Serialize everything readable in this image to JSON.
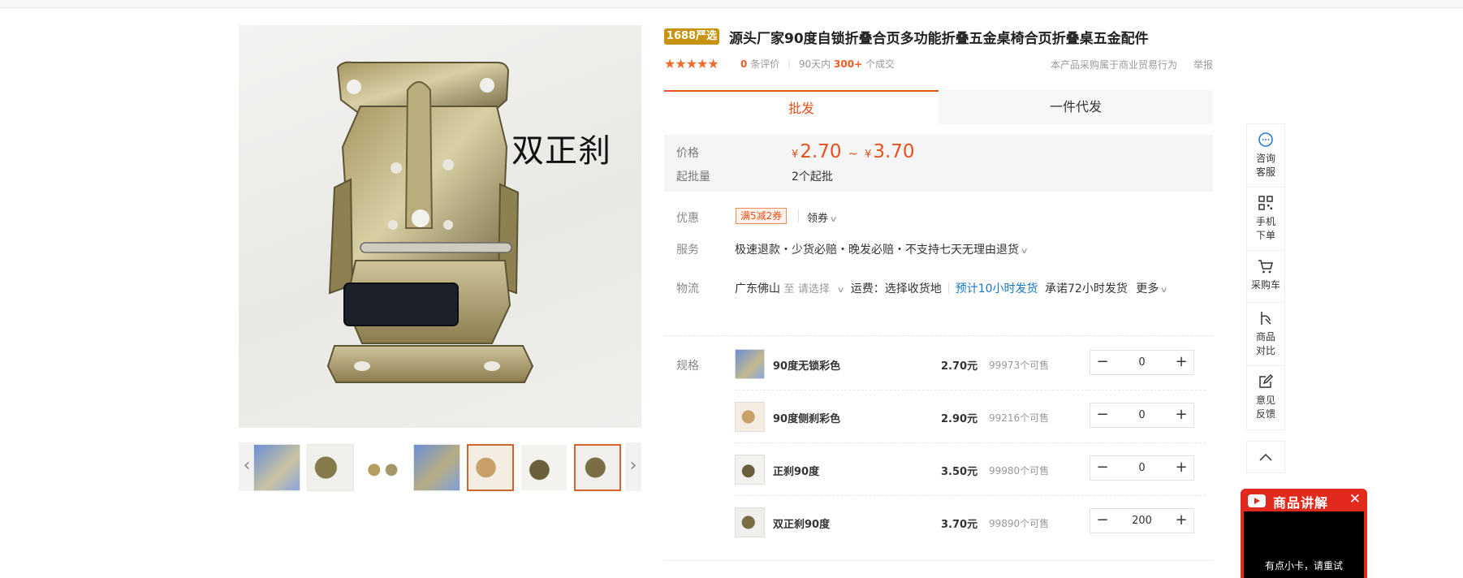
{
  "gallery": {
    "main_caption": "双正刹",
    "prev_arrow": "‹",
    "next_arrow": "›"
  },
  "product": {
    "badge": "1688严选",
    "title": "源头厂家90度自锁折叠合页多功能折叠五金桌椅合页折叠桌五金配件",
    "stars": "★★★★★",
    "reviews_count": "0",
    "reviews_label": "条评价",
    "sales_prefix": "90天内",
    "sales_count": "300+",
    "sales_suffix": "个成交",
    "trade_note": "本产品采购属于商业贸易行为",
    "report": "举报"
  },
  "tabs": [
    {
      "label": "批发",
      "active": true
    },
    {
      "label": "一件代发",
      "active": false
    }
  ],
  "pricing": {
    "price_label": "价格",
    "currency": "¥",
    "price_low": "2.70",
    "tilde": "~",
    "price_high": "3.70",
    "moq_label": "起批量",
    "moq_value": "2个起批"
  },
  "promo": {
    "label": "优惠",
    "coupon": "满5减2券",
    "get_coupon": "领券"
  },
  "service": {
    "label": "服务",
    "text": "极速退款・少货必赔・晚发必赔・不支持七天无理由退货"
  },
  "logistics": {
    "label": "物流",
    "origin": "广东佛山",
    "to": "至",
    "select": "请选择",
    "fee": "运费：选择收货地",
    "eta": "预计10小时发货",
    "promise": "承诺72小时发货",
    "more": "更多"
  },
  "spec": {
    "label": "规格",
    "items": [
      {
        "name": "90度无锁彩色",
        "price": "2.70元",
        "stock": "99973个可售",
        "qty": "0"
      },
      {
        "name": "90度侧刹彩色",
        "price": "2.90元",
        "stock": "99216个可售",
        "qty": "0"
      },
      {
        "name": "正刹90度",
        "price": "3.50元",
        "stock": "99980个可售",
        "qty": "0"
      },
      {
        "name": "双正刹90度",
        "price": "3.70元",
        "stock": "99890个可售",
        "qty": "200"
      }
    ]
  },
  "sidebar": {
    "items": [
      {
        "label": "咨询客服",
        "icon": "chat-icon"
      },
      {
        "label": "手机下单",
        "icon": "qrcode-icon"
      },
      {
        "label": "采购车",
        "icon": "cart-icon"
      },
      {
        "label": "商品对比",
        "icon": "compare-icon"
      },
      {
        "label": "意见反馈",
        "icon": "feedback-icon"
      }
    ],
    "back_top_icon": "chevron-up-icon"
  },
  "live": {
    "title": "商品讲解",
    "close": "✕",
    "message": "有点小卡，请重试"
  },
  "colors": {
    "accent": "#e8501c",
    "badge": "#c8940f",
    "link": "#1677c8",
    "live": "#e12a1d"
  }
}
